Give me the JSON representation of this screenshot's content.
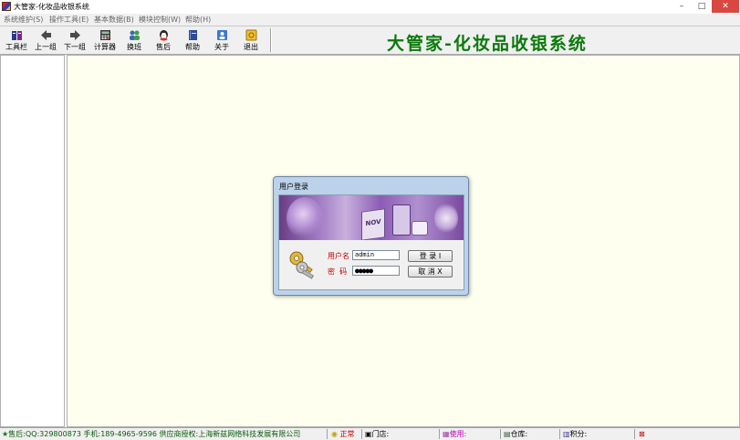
{
  "window": {
    "title": "大管家-化妆品收银系统",
    "controls": {
      "minimize": "–",
      "maximize": "□",
      "close": "✕"
    }
  },
  "menu": [
    {
      "label": "系统维护(S)"
    },
    {
      "label": "操作工具(E)"
    },
    {
      "label": "基本数据(B)"
    },
    {
      "label": "模块控制(W)"
    },
    {
      "label": "帮助(H)"
    }
  ],
  "toolbar": {
    "buttons": [
      {
        "label": "工具栏",
        "icon": "toolbox-icon"
      },
      {
        "label": "上一组",
        "icon": "arrow-left-icon"
      },
      {
        "label": "下一组",
        "icon": "arrow-right-icon"
      },
      {
        "label": "计算器",
        "icon": "calculator-icon"
      },
      {
        "label": "换班",
        "icon": "shift-change-icon"
      },
      {
        "label": "售后",
        "icon": "after-sales-icon"
      },
      {
        "label": "帮助",
        "icon": "help-book-icon"
      },
      {
        "label": "关于",
        "icon": "about-icon"
      },
      {
        "label": "退出",
        "icon": "exit-icon"
      }
    ],
    "brand": "大管家-化妆品收银系统"
  },
  "login": {
    "title": "用户登录",
    "username_label": "用户名",
    "username_value": "admin",
    "password_label": "密  码",
    "password_value": "●●●●●",
    "login_button": "登 录 I",
    "cancel_button": "取 消 X",
    "banner_text": "NOV"
  },
  "status": {
    "support": "售后:QQ:329800873 手机:189-4965-9596 供应商授权:上海新兹网络科技发展有限公司",
    "state": "正常",
    "store_label": "门店:",
    "user_label": "使用:",
    "warehouse_label": "仓库:",
    "points_label": "积分:"
  },
  "colors": {
    "brand": "#0a7a0a",
    "status_alert": "#c00000",
    "main_bg": "#fffff0"
  }
}
